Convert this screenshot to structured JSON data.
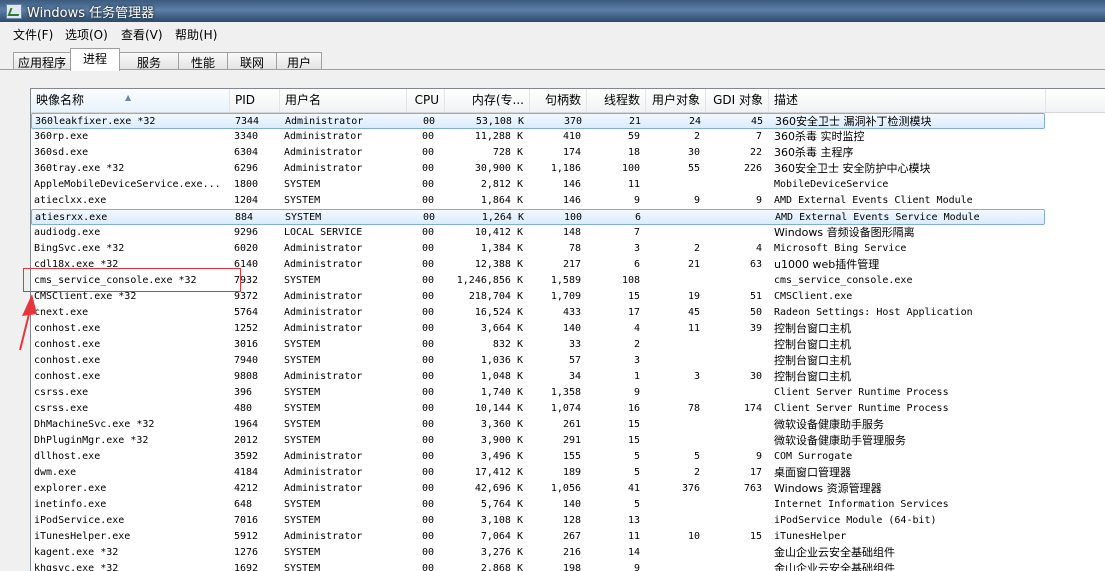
{
  "window": {
    "title": "Windows 任务管理器"
  },
  "menu": [
    {
      "label": "文件(F)"
    },
    {
      "label": "选项(O)"
    },
    {
      "label": "查看(V)"
    },
    {
      "label": "帮助(H)"
    }
  ],
  "tabs": [
    {
      "label": "应用程序"
    },
    {
      "label": "进程"
    },
    {
      "label": "服务"
    },
    {
      "label": "性能"
    },
    {
      "label": "联网"
    },
    {
      "label": "用户"
    }
  ],
  "active_tab": "进程",
  "columns": [
    {
      "label": "映像名称"
    },
    {
      "label": "PID"
    },
    {
      "label": "用户名"
    },
    {
      "label": "CPU"
    },
    {
      "label": "内存(专..."
    },
    {
      "label": "句柄数"
    },
    {
      "label": "线程数"
    },
    {
      "label": "用户对象"
    },
    {
      "label": "GDI 对象"
    },
    {
      "label": "描述"
    }
  ],
  "rows": [
    [
      "360leakfixer.exe *32",
      "7344",
      "Administrator",
      "00",
      "53,108 K",
      "370",
      "21",
      "24",
      "45",
      "360安全卫士 漏洞补丁检测模块"
    ],
    [
      "360rp.exe",
      "3340",
      "Administrator",
      "00",
      "11,288 K",
      "410",
      "59",
      "2",
      "7",
      "360杀毒 实时监控"
    ],
    [
      "360sd.exe",
      "6304",
      "Administrator",
      "00",
      "728 K",
      "174",
      "18",
      "30",
      "22",
      "360杀毒 主程序"
    ],
    [
      "360tray.exe *32",
      "6296",
      "Administrator",
      "00",
      "30,900 K",
      "1,186",
      "100",
      "55",
      "226",
      "360安全卫士 安全防护中心模块"
    ],
    [
      "AppleMobileDeviceService.exe...",
      "1800",
      "SYSTEM",
      "00",
      "2,812 K",
      "146",
      "11",
      "",
      "",
      "MobileDeviceService"
    ],
    [
      "atieclxx.exe",
      "1204",
      "SYSTEM",
      "00",
      "1,864 K",
      "146",
      "9",
      "9",
      "9",
      "AMD External Events Client Module"
    ],
    [
      "atiesrxx.exe",
      "884",
      "SYSTEM",
      "00",
      "1,264 K",
      "100",
      "6",
      "",
      "",
      "AMD External Events Service Module"
    ],
    [
      "audiodg.exe",
      "9296",
      "LOCAL SERVICE",
      "00",
      "10,412 K",
      "148",
      "7",
      "",
      "",
      "Windows 音频设备图形隔离"
    ],
    [
      "BingSvc.exe *32",
      "6020",
      "Administrator",
      "00",
      "1,384 K",
      "78",
      "3",
      "2",
      "4",
      "Microsoft Bing Service"
    ],
    [
      "cdl18x.exe *32",
      "6140",
      "Administrator",
      "00",
      "12,388 K",
      "217",
      "6",
      "21",
      "63",
      "u1000 web插件管理"
    ],
    [
      "cms_service_console.exe *32",
      "7932",
      "SYSTEM",
      "00",
      "1,246,856 K",
      "1,589",
      "108",
      "",
      "",
      "cms_service_console.exe"
    ],
    [
      "CMSClient.exe *32",
      "9372",
      "Administrator",
      "00",
      "218,704 K",
      "1,709",
      "15",
      "19",
      "51",
      "CMSClient.exe"
    ],
    [
      "cnext.exe",
      "5764",
      "Administrator",
      "00",
      "16,524 K",
      "433",
      "17",
      "45",
      "50",
      "Radeon Settings: Host Application"
    ],
    [
      "conhost.exe",
      "1252",
      "Administrator",
      "00",
      "3,664 K",
      "140",
      "4",
      "11",
      "39",
      "控制台窗口主机"
    ],
    [
      "conhost.exe",
      "3016",
      "SYSTEM",
      "00",
      "832 K",
      "33",
      "2",
      "",
      "",
      "控制台窗口主机"
    ],
    [
      "conhost.exe",
      "7940",
      "SYSTEM",
      "00",
      "1,036 K",
      "57",
      "3",
      "",
      "",
      "控制台窗口主机"
    ],
    [
      "conhost.exe",
      "9808",
      "Administrator",
      "00",
      "1,048 K",
      "34",
      "1",
      "3",
      "30",
      "控制台窗口主机"
    ],
    [
      "csrss.exe",
      "396",
      "SYSTEM",
      "00",
      "1,740 K",
      "1,358",
      "9",
      "",
      "",
      "Client Server Runtime Process"
    ],
    [
      "csrss.exe",
      "480",
      "SYSTEM",
      "00",
      "10,144 K",
      "1,074",
      "16",
      "78",
      "174",
      "Client Server Runtime Process"
    ],
    [
      "DhMachineSvc.exe *32",
      "1964",
      "SYSTEM",
      "00",
      "3,360 K",
      "261",
      "15",
      "",
      "",
      "微软设备健康助手服务"
    ],
    [
      "DhPluginMgr.exe *32",
      "2012",
      "SYSTEM",
      "00",
      "3,900 K",
      "291",
      "15",
      "",
      "",
      "微软设备健康助手管理服务"
    ],
    [
      "dllhost.exe",
      "3592",
      "Administrator",
      "00",
      "3,496 K",
      "155",
      "5",
      "5",
      "9",
      "COM Surrogate"
    ],
    [
      "dwm.exe",
      "4184",
      "Administrator",
      "00",
      "17,412 K",
      "189",
      "5",
      "2",
      "17",
      "桌面窗口管理器"
    ],
    [
      "explorer.exe",
      "4212",
      "Administrator",
      "00",
      "42,696 K",
      "1,056",
      "41",
      "376",
      "763",
      "Windows 资源管理器"
    ],
    [
      "inetinfo.exe",
      "648",
      "SYSTEM",
      "00",
      "5,764 K",
      "140",
      "5",
      "",
      "",
      "Internet Information Services"
    ],
    [
      "iPodService.exe",
      "7016",
      "SYSTEM",
      "00",
      "3,108 K",
      "128",
      "13",
      "",
      "",
      "iPodService Module (64-bit)"
    ],
    [
      "iTunesHelper.exe",
      "5912",
      "Administrator",
      "00",
      "7,064 K",
      "267",
      "11",
      "10",
      "15",
      "iTunesHelper"
    ],
    [
      "kagent.exe *32",
      "1276",
      "SYSTEM",
      "00",
      "3,276 K",
      "216",
      "14",
      "",
      "",
      "金山企业云安全基础组件"
    ],
    [
      "khgsvc.exe *32",
      "1692",
      "SYSTEM",
      "00",
      "2,868 K",
      "198",
      "9",
      "",
      "",
      "金山企业云安全基础组件"
    ]
  ]
}
